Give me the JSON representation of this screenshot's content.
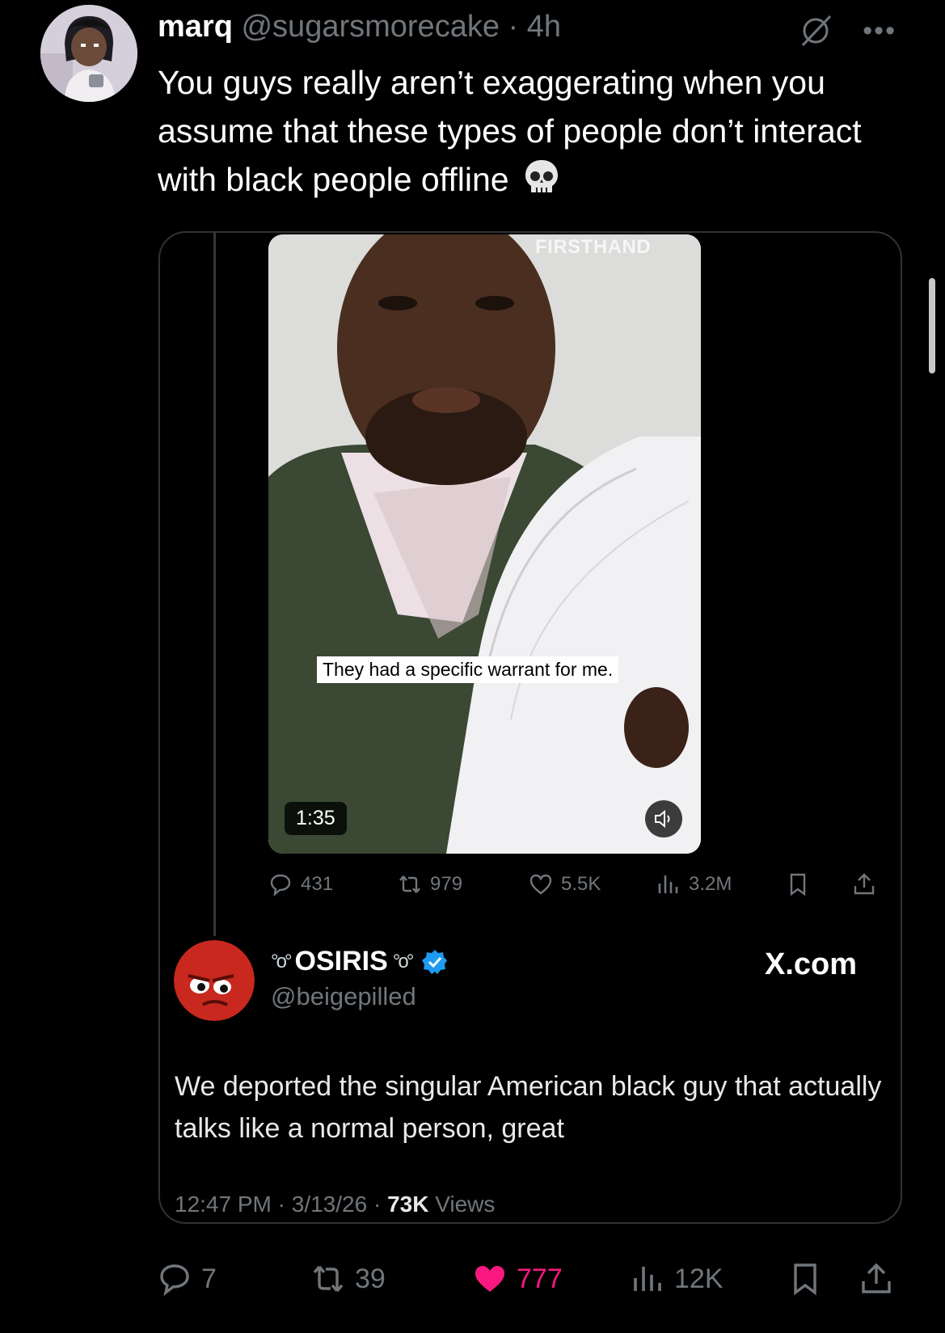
{
  "post": {
    "name": "marq",
    "handle": "@sugarsmorecake",
    "separator": "·",
    "time": "4h",
    "text": "You guys really aren’t exaggerating when you assume that these types of people don’t interact with black people offline",
    "emoji": "skull-icon",
    "actions": {
      "replies": "7",
      "reposts": "39",
      "likes": "777",
      "views": "12K"
    }
  },
  "video": {
    "watermark": "FIRSTHAND",
    "caption": "They had a specific warrant for me.",
    "duration": "1:35",
    "actions": {
      "replies": "431",
      "reposts": "979",
      "likes": "5.5K",
      "views": "3.2M"
    }
  },
  "quote": {
    "name": "OSIRIS",
    "name_decoration": "°o°",
    "handle": "@beigepilled",
    "source": "X.com",
    "text": "We deported the singular American black guy that actually talks like a normal person, great",
    "time": "12:47 PM",
    "date": "3/13/26",
    "views_count": "73K",
    "views_label": "Views"
  },
  "colors": {
    "background": "#000000",
    "text": "#e7e9ea",
    "muted": "#71767b",
    "like": "#f91880",
    "verified": "#1d9bf0"
  }
}
